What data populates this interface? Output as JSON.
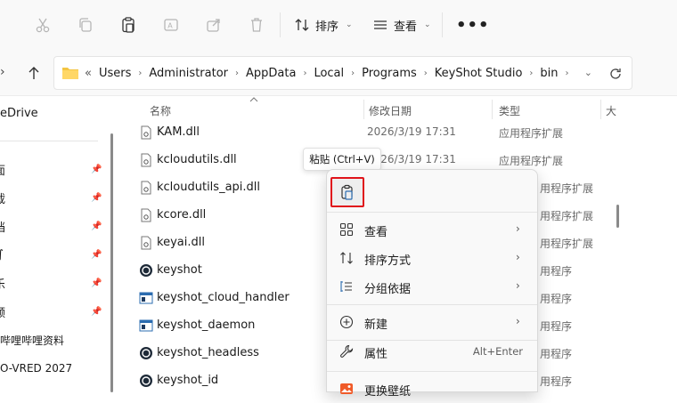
{
  "toolbar": {
    "sort_label": "排序",
    "view_label": "查看",
    "more_label": "•••"
  },
  "address": {
    "overflow": "«",
    "crumbs": [
      "Users",
      "Administrator",
      "AppData",
      "Local",
      "Programs",
      "KeyShot Studio",
      "bin"
    ]
  },
  "nav": {
    "items": [
      "eDrive",
      "面",
      "载",
      "档",
      "∫",
      "乐",
      "频",
      "哔哩哔哩资料",
      "O-VRED 2027"
    ]
  },
  "columns": {
    "name": "名称",
    "date": "修改日期",
    "type": "类型",
    "size": "大"
  },
  "files": [
    {
      "name": "KAM.dll",
      "date": "2026/3/19 17:31",
      "type": "应用程序扩展",
      "icon": "dll-icon"
    },
    {
      "name": "kcloudutils.dll",
      "date": "2026/3/19 17:31",
      "type": "应用程序扩展",
      "icon": "dll-icon"
    },
    {
      "name": "kcloudutils_api.dll",
      "date": "",
      "type": "用程序扩展",
      "icon": "dll-icon"
    },
    {
      "name": "kcore.dll",
      "date": "",
      "type": "用程序扩展",
      "icon": "dll-icon"
    },
    {
      "name": "keyai.dll",
      "date": "",
      "type": "用程序扩展",
      "icon": "dll-icon"
    },
    {
      "name": "keyshot",
      "date": "",
      "type": "用程序",
      "icon": "keyshot-icon"
    },
    {
      "name": "keyshot_cloud_handler",
      "date": "",
      "type": "用程序",
      "icon": "app-window-icon"
    },
    {
      "name": "keyshot_daemon",
      "date": "",
      "type": "用程序",
      "icon": "app-window-icon"
    },
    {
      "name": "keyshot_headless",
      "date": "",
      "type": "用程序",
      "icon": "keyshot-icon"
    },
    {
      "name": "keyshot_id",
      "date": "",
      "type": "用程序",
      "icon": "keyshot-icon"
    }
  ],
  "tooltip": {
    "text": "粘贴 (Ctrl+V)"
  },
  "context_menu": {
    "paste_icon": "paste-icon",
    "items": [
      {
        "label": "查看",
        "icon": "grid-icon",
        "arrow": "›",
        "shortcut": ""
      },
      {
        "label": "排序方式",
        "icon": "sort-icon",
        "arrow": "›",
        "shortcut": ""
      },
      {
        "label": "分组依据",
        "icon": "group-icon",
        "arrow": "›",
        "shortcut": ""
      },
      {
        "label": "新建",
        "icon": "plus-circle-icon",
        "arrow": "›",
        "shortcut": ""
      },
      {
        "label": "属性",
        "icon": "wrench-icon",
        "arrow": "",
        "shortcut": "Alt+Enter"
      },
      {
        "label": "更换壁纸",
        "icon": "wallpaper-icon",
        "arrow": "",
        "shortcut": ""
      }
    ]
  },
  "colors": {
    "highlight_border": "#e0141b",
    "folder_yellow": "#f4c542"
  }
}
